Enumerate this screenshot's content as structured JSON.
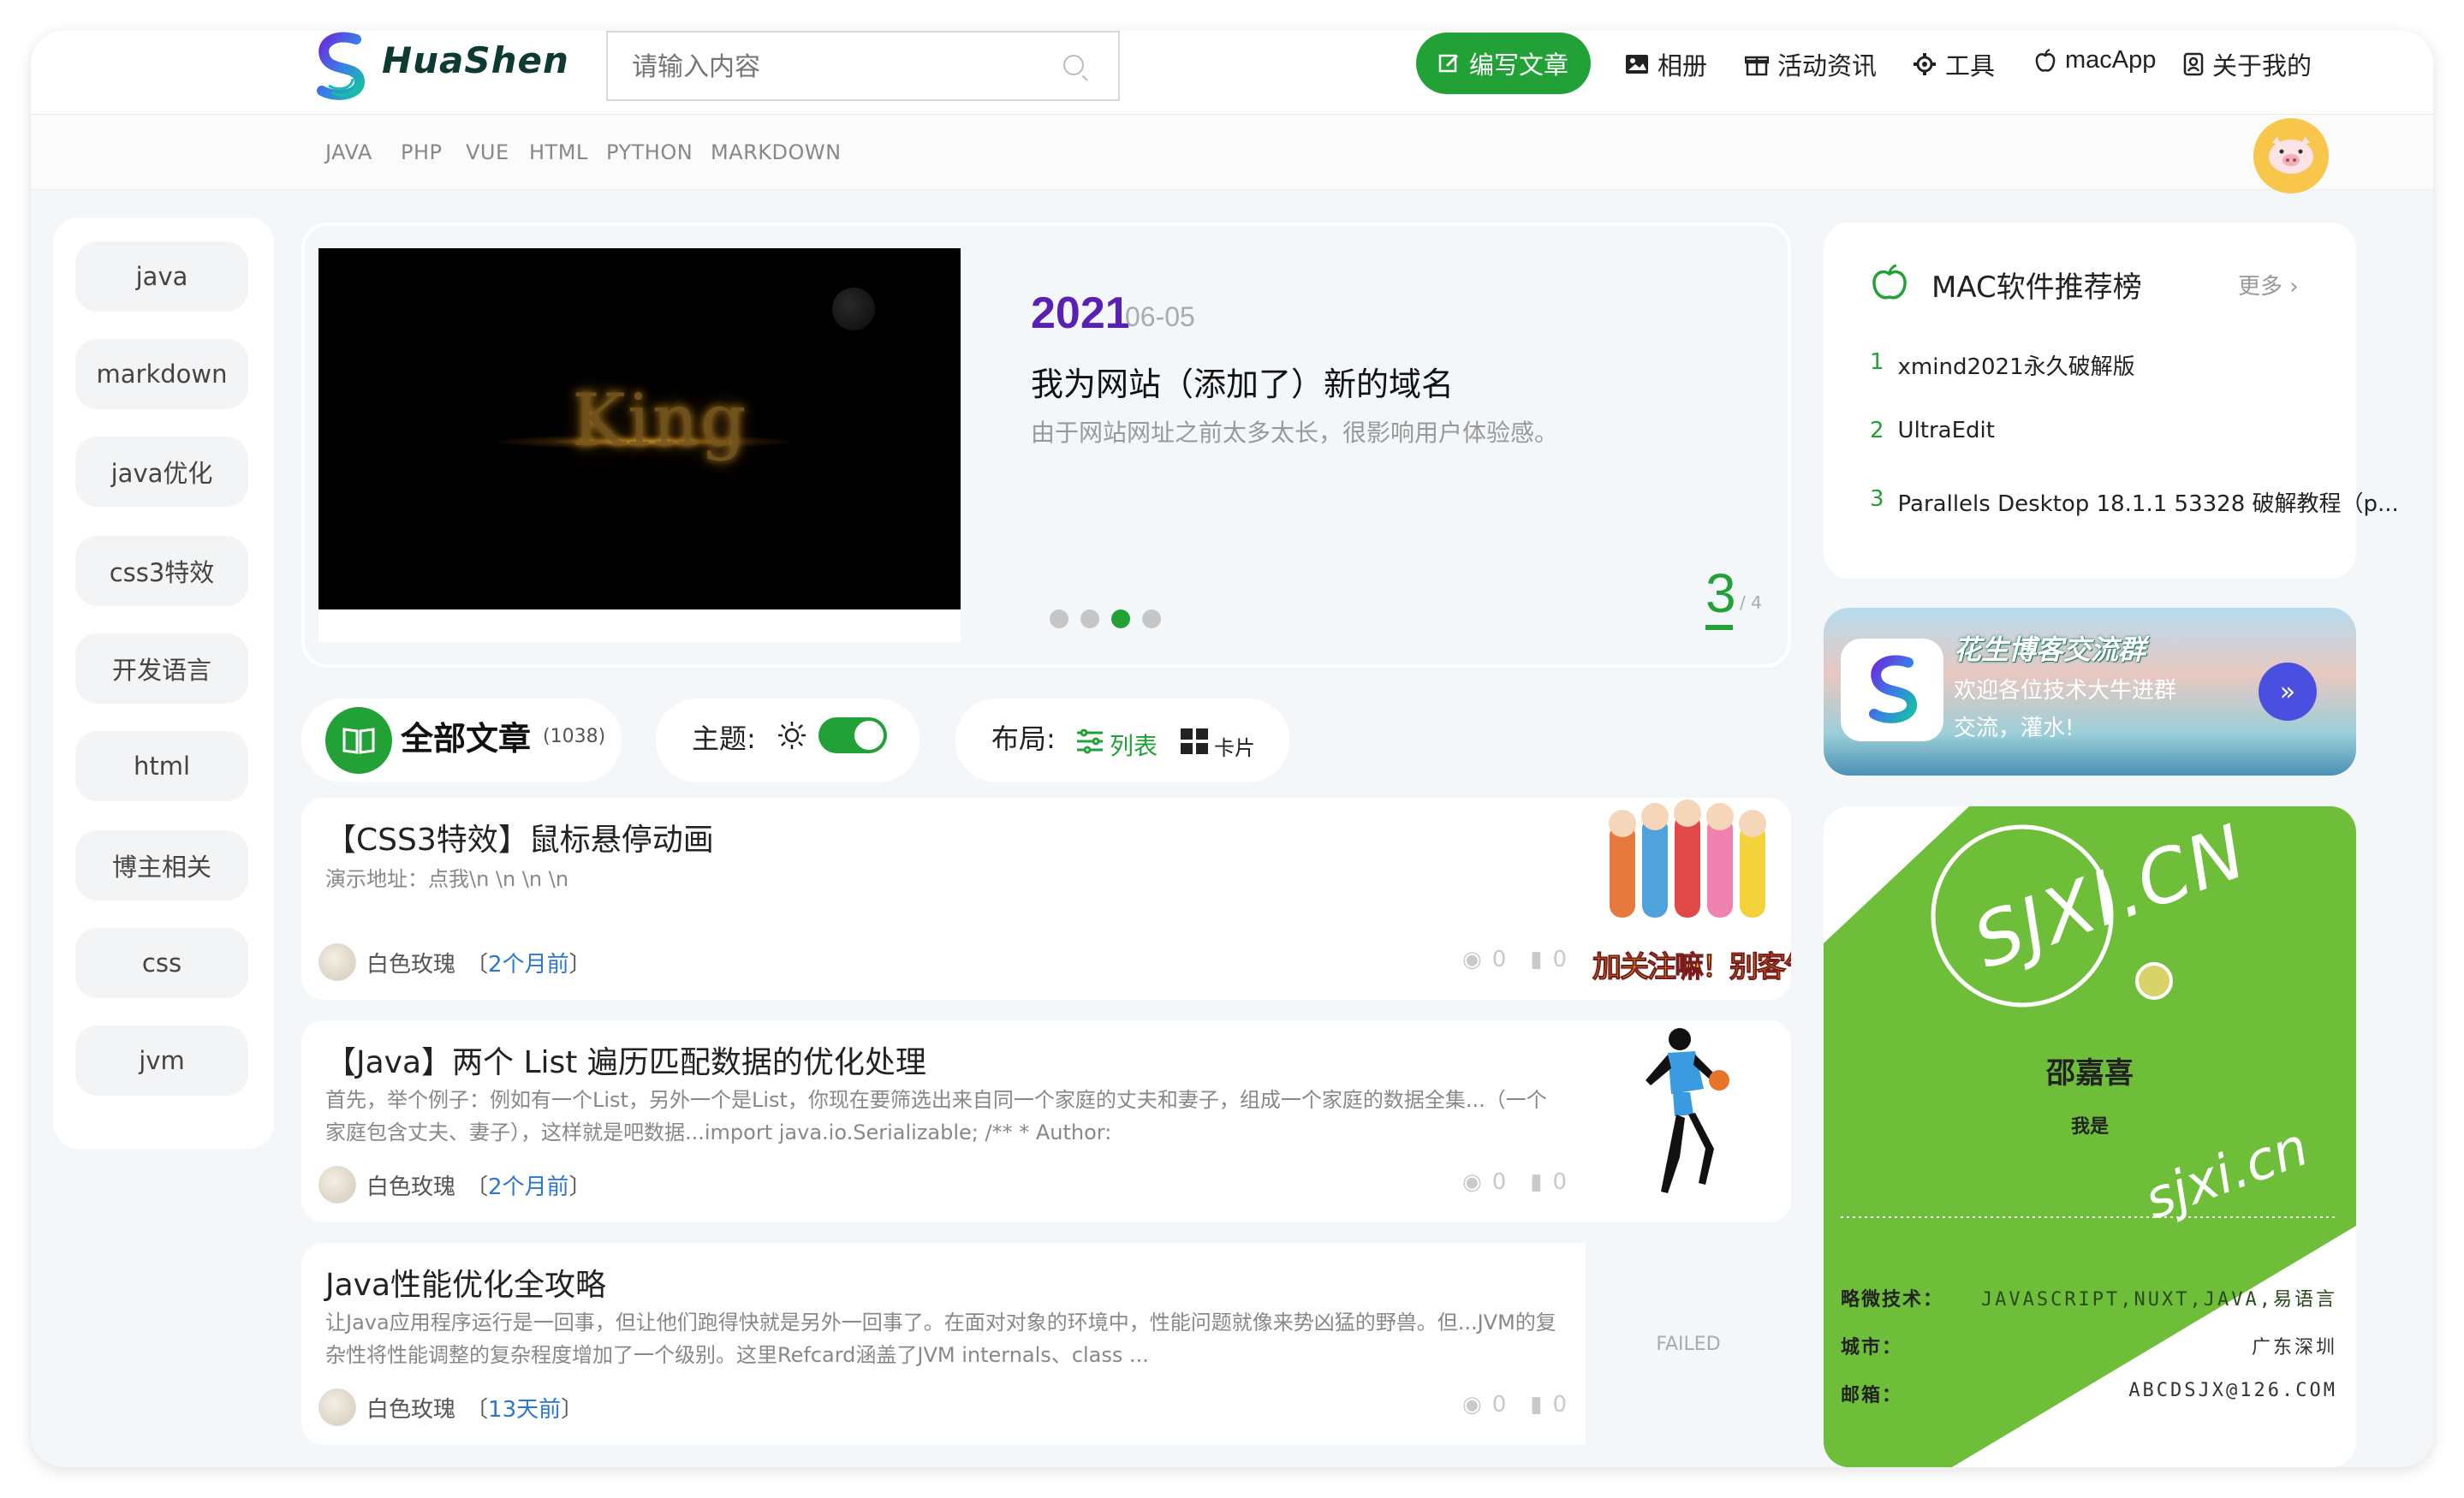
{
  "header": {
    "brand": "HuaShen",
    "search_placeholder": "请输入内容",
    "write_label": "编写文章",
    "nav": [
      {
        "label": "相册",
        "icon": "image-icon"
      },
      {
        "label": "活动资讯",
        "icon": "gift-icon"
      },
      {
        "label": "工具",
        "icon": "gear-icon"
      },
      {
        "label": "macApp",
        "icon": "apple-icon"
      },
      {
        "label": "关于我的",
        "icon": "user-lock-icon"
      }
    ]
  },
  "subnav": [
    "JAVA",
    "PHP",
    "VUE",
    "HTML",
    "PYTHON",
    "MARKDOWN"
  ],
  "sidebar": {
    "tags": [
      "java",
      "markdown",
      "java优化",
      "css3特效",
      "开发语言",
      "html",
      "博主相关",
      "css",
      "jvm"
    ]
  },
  "carousel": {
    "image_text": "King",
    "year": "2021",
    "date": "06-05",
    "title": "我为网站（添加了）新的域名",
    "desc": "由于网站网址之前太多太长，很影响用户体验感。",
    "current": "3",
    "total": "/ 4",
    "dots_count": 4,
    "active_dot": 3
  },
  "toolbar": {
    "all_label": "全部文章",
    "count": "(1038)",
    "theme_label": "主题:",
    "layout_label": "布局:",
    "list_label": "列表",
    "card_label": "卡片"
  },
  "posts": [
    {
      "title": "【CSS3特效】鼠标悬停动画",
      "desc": "演示地址：点我\\n \\n \\n \\n",
      "author": "白色玫瑰",
      "time": "2个月前",
      "views": "0",
      "comments": "0",
      "thumb_text": "加关注嘛！别客气~~"
    },
    {
      "title": "【Java】两个 List 遍历匹配数据的优化处理",
      "desc": "首先，举个例子：例如有一个List，另外一个是List，你现在要筛选出来自同一个家庭的丈夫和妻子，组成一个家庭的数据全集...（一个家庭包含丈夫、妻子），这样就是吧数据...import java.io.Serializable; /** * Author:",
      "author": "白色玫瑰",
      "time": "2个月前",
      "views": "0",
      "comments": "0",
      "thumb_text": ""
    },
    {
      "title": "Java性能优化全攻略",
      "desc": "让Java应用程序运行是一回事，但让他们跑得快就是另外一回事了。在面对对象的环境中，性能问题就像来势凶猛的野兽。但...JVM的复杂性将性能调整的复杂程度增加了一个级别。这里Refcard涵盖了JVM internals、class ...",
      "author": "白色玫瑰",
      "time": "13天前",
      "views": "0",
      "comments": "0",
      "thumb_text": "FAILED"
    }
  ],
  "mac": {
    "title": "MAC软件推荐榜",
    "more": "更多",
    "items": [
      {
        "n": "1",
        "name": "xmind2021永久破解版"
      },
      {
        "n": "2",
        "name": "UltraEdit"
      },
      {
        "n": "3",
        "name": "Parallels Desktop 18.1.1 53328 破解教程（p..."
      }
    ]
  },
  "group": {
    "title": "花生博客交流群",
    "desc1": "欢迎各位技术大牛进群",
    "desc2": "交流，灌水!"
  },
  "profile": {
    "watermark": "SJXI.CN",
    "name": "邵嘉喜",
    "intro": "我是",
    "site": "sjxi.cn",
    "rows": [
      {
        "label": "略微技术：",
        "value": "JAVASCRIPT,NUXT,JAVA,易语言"
      },
      {
        "label": "城市：",
        "value": "广东深圳"
      },
      {
        "label": "邮箱：",
        "value": "ABCDSJX@126.COM"
      }
    ]
  },
  "colors": {
    "accent": "#21a136",
    "year": "#5a1fb5",
    "profile_green": "#6fbe3a",
    "time_link": "#2a76d2"
  }
}
